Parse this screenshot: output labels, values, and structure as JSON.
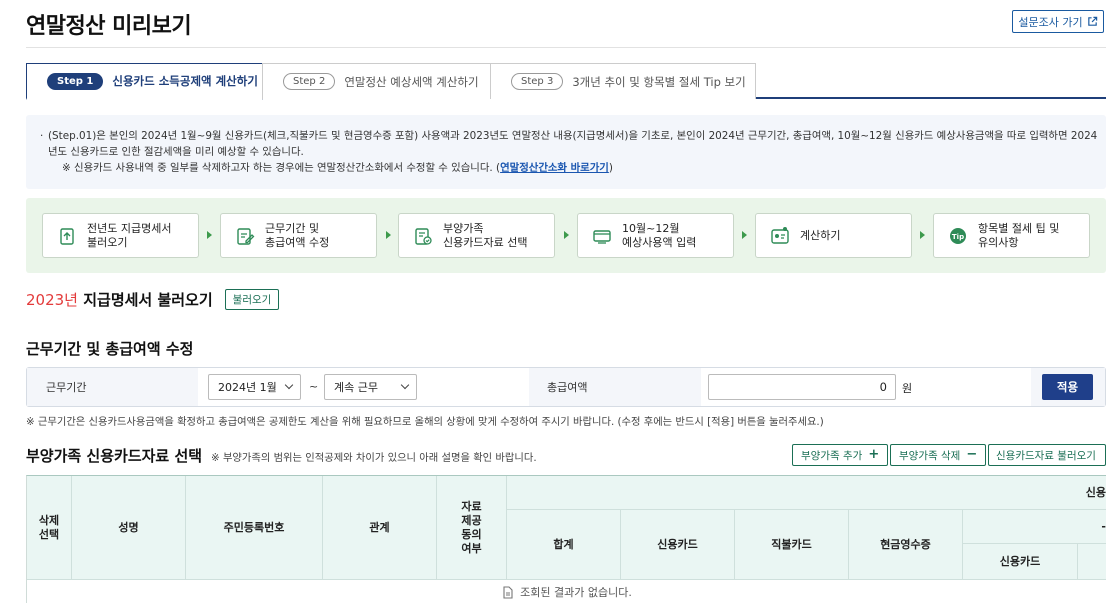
{
  "page": {
    "title": "연말정산 미리보기",
    "survey_label": "설문조사 가기"
  },
  "tabs": [
    {
      "step": "Step 1",
      "label": "신용카드 소득공제액 계산하기",
      "active": true
    },
    {
      "step": "Step 2",
      "label": "연말정산 예상세액 계산하기",
      "active": false
    },
    {
      "step": "Step 3",
      "label": "3개년 추이 및 항목별 절세 Tip 보기",
      "active": false
    }
  ],
  "notice": {
    "bullet": "·",
    "line1": "(Step.01)은 본인의 2024년 1월~9월 신용카드(체크,직불카드 및 현금영수증 포함) 사용액과 2023년도 연말정산 내용(지급명세서)을 기초로, 본인이 2024년 근무기간, 총급여액, 10월~12월 신용카드 예상사용금액을 따로 입력하면 2024년도 신용카드로 인한 절감세액을 미리 예상할 수 있습니다.",
    "line2_prefix": "※ 신용카드 사용내역 중 일부를 삭제하고자 하는 경우에는 연말정산간소화에서 수정할 수 있습니다. (",
    "link": "연말정산간소화 바로가기",
    "line2_suffix": ")"
  },
  "flow": [
    {
      "label1": "전년도 지급명세서",
      "label2": "불러오기",
      "icon": "upload-doc-icon"
    },
    {
      "label1": "근무기간 및",
      "label2": "총급여액 수정",
      "icon": "edit-doc-icon"
    },
    {
      "label1": "부양가족",
      "label2": "신용카드자료 선택",
      "icon": "check-doc-icon"
    },
    {
      "label1": "10월~12월",
      "label2": "예상사용액 입력",
      "icon": "card-input-icon"
    },
    {
      "label1": "계산하기",
      "label2": "",
      "icon": "calculator-icon"
    },
    {
      "label1": "항목별 절세 팁 및",
      "label2": "유의사항",
      "icon": "tip-icon"
    }
  ],
  "section1": {
    "year": "2023년",
    "title": "지급명세서 불러오기",
    "button": "불러오기"
  },
  "section2": {
    "title": "근무기간 및 총급여액 수정"
  },
  "form": {
    "period_label": "근무기간",
    "start_month": "2024년 1월",
    "tilde": "~",
    "end_status": "계속 근무",
    "salary_label": "총급여액",
    "salary_value": "0",
    "unit": "원",
    "apply_label": "적용",
    "note": "※ 근무기간은 신용카드사용금액을 확정하고 총급여액은 공제한도 계산을 위해 필요하므로 올해의 상황에 맞게 수정하여 주시기 바랍니다. (수정 후에는 반드시 [적용] 버튼을 눌러주세요.)"
  },
  "section3": {
    "title": "부양가족 신용카드자료 선택",
    "note": "※ 부양가족의 범위는 인적공제와 차이가 있으니 아래 설명을 확인 바랍니다.",
    "add_label": "부양가족 추가",
    "add_symbol": "+",
    "delete_label": "부양가족 삭제",
    "delete_symbol": "−",
    "load_label": "신용카드자료 불러오기"
  },
  "table": {
    "headers": {
      "delete_select": "삭제\n선택",
      "name": "성명",
      "rrn": "주민등록번호",
      "relation": "관계",
      "consent": "자료\n제공\n동의\n여부",
      "group_top": "신용",
      "total": "합계",
      "credit_card": "신용카드",
      "debit_card": "직불카드",
      "cash_receipt": "현금영수증",
      "sub_credit": "신용카드",
      "sub_group": "-"
    },
    "empty_text": "조회된 결과가 없습니다."
  },
  "colors": {
    "primary": "#1f3f7a",
    "green": "#1b6f55",
    "red_year": "#e33b3b",
    "flow_bg": "#eaf5e9",
    "notice_bg": "#f3f6fb"
  }
}
